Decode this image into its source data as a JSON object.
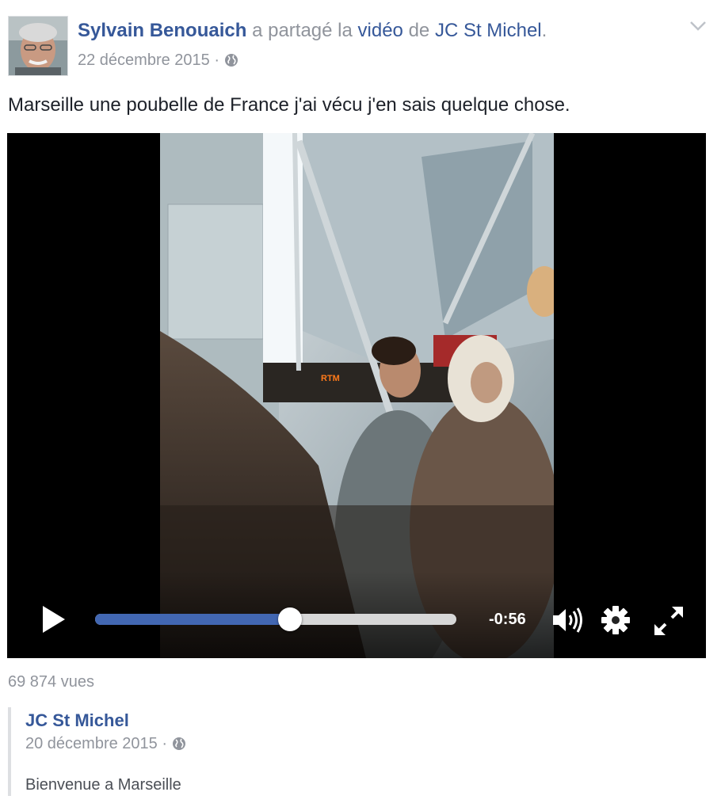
{
  "post": {
    "author": "Sylvain Benouaich",
    "action_1": "a partagé la",
    "link_video": "vidéo",
    "action_2": "de",
    "shared_from": "JC St Michel",
    "punct": ".",
    "date": "22 décembre 2015",
    "separator": "·",
    "privacy_icon": "globe-icon",
    "text": "Marseille une poubelle de France j'ai vécu j'en sais quelque chose."
  },
  "video": {
    "time_remaining": "-0:56",
    "progress": 0.54,
    "overlay_sign": "RTM",
    "icons": [
      "play-icon",
      "volume-icon",
      "gear-icon",
      "fullscreen-icon"
    ]
  },
  "views": "69 874 vues",
  "shared": {
    "author": "JC St Michel",
    "date": "20 décembre 2015",
    "separator": "·",
    "text": "Bienvenue a Marseille"
  },
  "colors": {
    "link": "#365899",
    "meta": "#90949c",
    "progress": "#4267b2"
  }
}
